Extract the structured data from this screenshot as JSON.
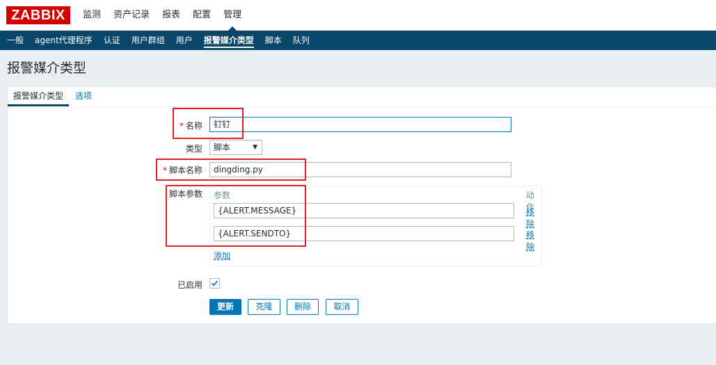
{
  "logo": "ZABBIX",
  "main_menu": [
    "监测",
    "资产记录",
    "报表",
    "配置",
    "管理"
  ],
  "sub_menu": [
    "一般",
    "agent代理程序",
    "认证",
    "用户群组",
    "用户",
    "报警媒介类型",
    "脚本",
    "队列"
  ],
  "page_title": "报警媒介类型",
  "tabs": [
    "报警媒介类型",
    "选项"
  ],
  "form": {
    "name_label": "名称",
    "name_value": "钉钉",
    "type_label": "类型",
    "type_value": "脚本",
    "script_name_label": "脚本名称",
    "script_name_value": "dingding.py",
    "script_params_label": "脚本参数",
    "params_header": "参数",
    "actions_header": "动作",
    "params": [
      "{ALERT.MESSAGE}",
      "{ALERT.SENDTO}"
    ],
    "remove_label": "移除",
    "add_label": "添加",
    "enabled_label": "已启用",
    "enabled": true,
    "required_mark": "*"
  },
  "buttons": {
    "update": "更新",
    "clone": "克隆",
    "delete": "删除",
    "cancel": "取消"
  },
  "colors": {
    "nav": "#0a466a",
    "link": "#0275b8",
    "logo": "#d40000",
    "annotation": "#e02020"
  }
}
